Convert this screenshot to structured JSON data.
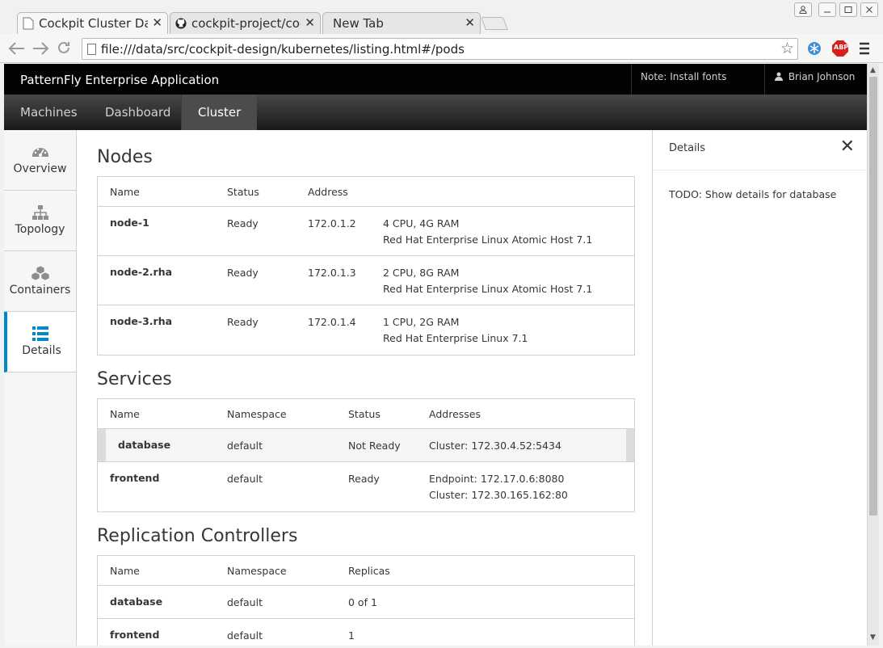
{
  "browser": {
    "tabs": [
      {
        "title": "Cockpit Cluster Dasl",
        "close": "✕"
      },
      {
        "title": "cockpit-project/cock",
        "close": "✕"
      },
      {
        "title": "New Tab",
        "close": "✕"
      }
    ],
    "url": "file:///data/src/cockpit-design/kubernetes/listing.html#/pods",
    "extensions": {
      "abp": "ABP"
    }
  },
  "app": {
    "brand": "PatternFly Enterprise Application",
    "note": "Note: Install fonts manually",
    "user": "Brian Johnson",
    "primary_nav": [
      "Machines",
      "Dashboard",
      "Cluster"
    ],
    "vertical_nav": [
      {
        "label": "Overview",
        "icon": "dashboard-icon"
      },
      {
        "label": "Topology",
        "icon": "sitemap-icon"
      },
      {
        "label": "Containers",
        "icon": "cubes-icon"
      },
      {
        "label": "Details",
        "icon": "list-icon"
      }
    ]
  },
  "nodes": {
    "title": "Nodes",
    "headers": [
      "Name",
      "Status",
      "Address"
    ],
    "rows": [
      {
        "name": "node-1",
        "status": "Ready",
        "address": "172.0.1.2",
        "spec": "4 CPU, 4G RAM",
        "os": "Red Hat Enterprise Linux Atomic Host 7.1"
      },
      {
        "name": "node-2.rha",
        "status": "Ready",
        "address": "172.0.1.3",
        "spec": "2 CPU, 8G RAM",
        "os": "Red Hat Enterprise Linux Atomic Host 7.1"
      },
      {
        "name": "node-3.rha",
        "status": "Ready",
        "address": "172.0.1.4",
        "spec": "1 CPU, 2G RAM",
        "os": "Red Hat Enterprise Linux 7.1"
      }
    ]
  },
  "services": {
    "title": "Services",
    "headers": [
      "Name",
      "Namespace",
      "Status",
      "Addresses"
    ],
    "rows": [
      {
        "name": "database",
        "namespace": "default",
        "status": "Not Ready",
        "addr1": "Cluster: 172.30.4.52:5434",
        "addr2": ""
      },
      {
        "name": "frontend",
        "namespace": "default",
        "status": "Ready",
        "addr1": "Endpoint: 172.17.0.6:8080",
        "addr2": "Cluster: 172.30.165.162:80"
      }
    ]
  },
  "replication": {
    "title": "Replication Controllers",
    "headers": [
      "Name",
      "Namespace",
      "Replicas"
    ],
    "rows": [
      {
        "name": "database",
        "namespace": "default",
        "replicas": "0 of 1"
      },
      {
        "name": "frontend",
        "namespace": "default",
        "replicas": "1"
      }
    ]
  },
  "details_panel": {
    "title": "Details",
    "close": "✕",
    "body": "TODO: Show details for database"
  }
}
